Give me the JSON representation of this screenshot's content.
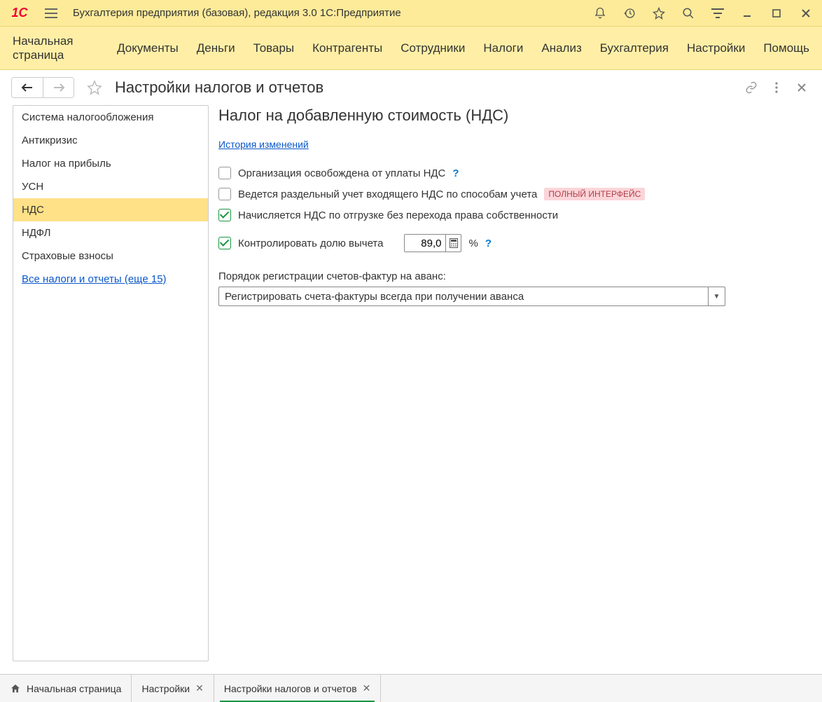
{
  "titlebar": {
    "app_title": "Бухгалтерия предприятия (базовая), редакция 3.0 1С:Предприятие"
  },
  "menubar": {
    "items": [
      "Начальная страница",
      "Документы",
      "Деньги",
      "Товары",
      "Контрагенты",
      "Сотрудники",
      "Налоги",
      "Анализ",
      "Бухгалтерия",
      "Настройки",
      "Помощь"
    ]
  },
  "page": {
    "title": "Настройки налогов и отчетов"
  },
  "sidebar": {
    "items": [
      {
        "label": "Система налогообложения",
        "selected": false
      },
      {
        "label": "Антикризис",
        "selected": false
      },
      {
        "label": "Налог на прибыль",
        "selected": false
      },
      {
        "label": "УСН",
        "selected": false
      },
      {
        "label": "НДС",
        "selected": true
      },
      {
        "label": "НДФЛ",
        "selected": false
      },
      {
        "label": "Страховые взносы",
        "selected": false
      }
    ],
    "all_link": "Все налоги и отчеты (еще 15)"
  },
  "vat": {
    "heading": "Налог на добавленную стоимость (НДС)",
    "history_link": "История изменений",
    "opt1_label": "Организация освобождена от уплаты НДС",
    "opt2_label": "Ведется раздельный учет входящего НДС по способам учета",
    "opt2_badge": "ПОЛНЫЙ ИНТЕРФЕЙС",
    "opt3_label": "Начисляется НДС по отгрузке без перехода права собственности",
    "opt4_label": "Контролировать долю вычета",
    "deduction_value": "89,0",
    "percent_sign": "%",
    "help_q": "?",
    "invoice_label": "Порядок регистрации счетов-фактур на аванс:",
    "invoice_value": "Регистрировать счета-фактуры всегда при получении аванса"
  },
  "footer": {
    "tabs": [
      {
        "label": "Начальная страница",
        "home": true,
        "closable": false,
        "active": false
      },
      {
        "label": "Настройки",
        "home": false,
        "closable": true,
        "active": false
      },
      {
        "label": "Настройки налогов и отчетов",
        "home": false,
        "closable": true,
        "active": true
      }
    ]
  }
}
